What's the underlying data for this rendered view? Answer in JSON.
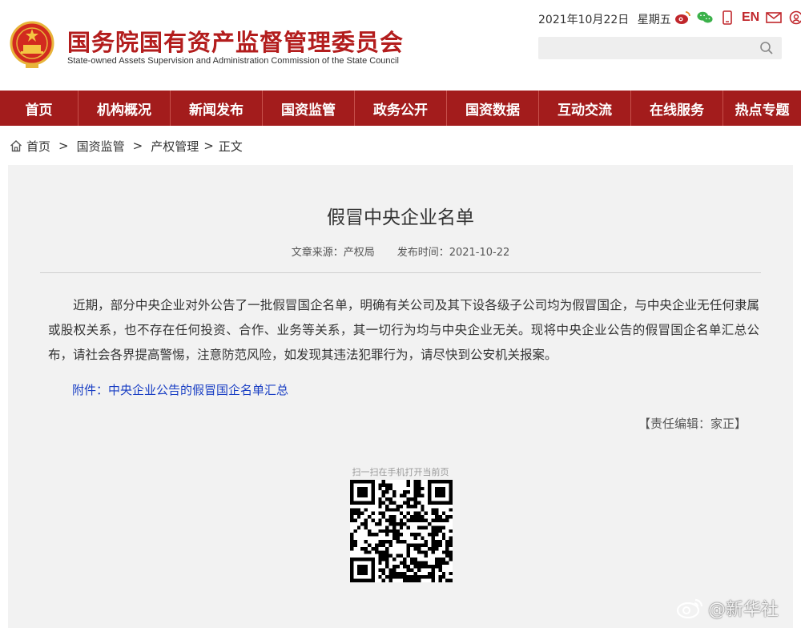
{
  "header": {
    "site_title": "国务院国有资产监督管理委员会",
    "site_subtitle": "State-owned Assets Supervision and Administration Commission of the State Council",
    "date": "2021年10月22日",
    "weekday": "星期五",
    "lang_label": "EN",
    "icons": [
      "weibo-icon",
      "wechat-icon",
      "mobile-icon",
      "mail-icon",
      "feedback-icon"
    ],
    "search_placeholder": ""
  },
  "nav": {
    "items": [
      "首页",
      "机构概况",
      "新闻发布",
      "国资监管",
      "政务公开",
      "国资数据",
      "互动交流",
      "在线服务",
      "热点专题"
    ]
  },
  "breadcrumb": {
    "items": [
      "首页",
      "国资监管",
      "产权管理",
      "正文"
    ]
  },
  "article": {
    "title": "假冒中央企业名单",
    "source": "文章来源：产权局",
    "published": "发布时间：2021-10-22",
    "body": "近期，部分中央企业对外公告了一批假冒国企名单，明确有关公司及其下设各级子公司均为假冒国企，与中央企业无任何隶属或股权关系，也不存在任何投资、合作、业务等关系，其一切行为均与中央企业无关。现将中央企业公告的假冒国企名单汇总公布，请社会各界提高警惕，注意防范风险，如发现其违法犯罪行为，请尽快到公安机关报案。",
    "attachment": "附件：中央企业公告的假冒国企名单汇总",
    "editor": "【责任编辑：家正】",
    "qr_caption": "扫一扫在手机打开当前页"
  },
  "watermark": {
    "text": "@新华社"
  },
  "colors": {
    "brand_red": "#a31c1c",
    "title_red": "#b31d1d",
    "link_blue": "#1a3fc4",
    "panel_bg": "#f2f2f2"
  }
}
